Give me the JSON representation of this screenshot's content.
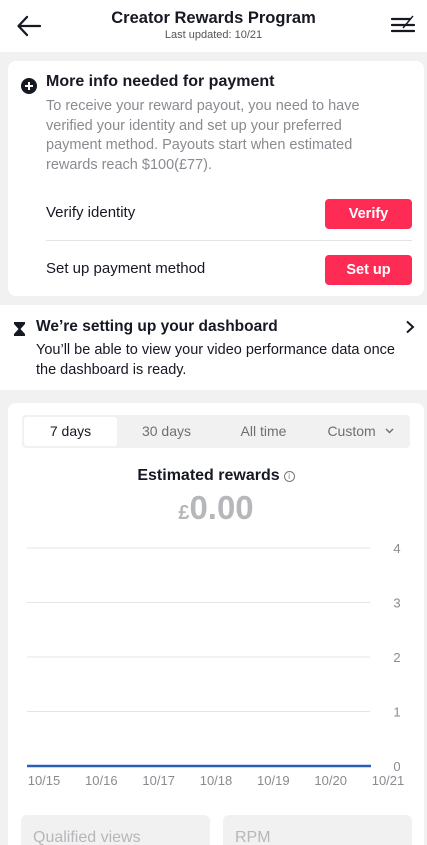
{
  "header": {
    "title": "Creator Rewards Program",
    "subtitle": "Last updated: 10/21"
  },
  "payment_card": {
    "title": "More info needed for payment",
    "body": "To receive your reward payout, you need to have verified your identity and set up your preferred payment method. Payouts start when estimated rewards reach $100(£77).",
    "rows": [
      {
        "label": "Verify identity",
        "button": "Verify"
      },
      {
        "label": "Set up payment method",
        "button": "Set up"
      }
    ]
  },
  "dashboard_notice": {
    "title": "We’re setting up your dashboard",
    "body": "You’ll be able to view your video performance data once the dashboard is ready."
  },
  "range_tabs": {
    "items": [
      "7 days",
      "30 days",
      "All time",
      "Custom"
    ],
    "selected": "7 days"
  },
  "rewards": {
    "title": "Estimated rewards",
    "currency": "£",
    "amount": "0.00"
  },
  "chart_data": {
    "type": "line",
    "x": [
      "10/15",
      "10/16",
      "10/17",
      "10/18",
      "10/19",
      "10/20",
      "10/21"
    ],
    "series": [
      {
        "values": [
          0,
          0,
          0,
          0,
          0,
          0,
          0
        ]
      }
    ],
    "y_ticks": [
      "0",
      "1",
      "2",
      "3",
      "4"
    ],
    "ylim": [
      0,
      4
    ],
    "grid": true,
    "colors": {
      "line": "#2b5fb3",
      "grid": "#e4e4e6",
      "tick": "#8a8b91"
    }
  },
  "metrics": {
    "qualified_views": "Qualified views",
    "rpm": "RPM"
  },
  "colors": {
    "accent": "#fe2c55"
  }
}
